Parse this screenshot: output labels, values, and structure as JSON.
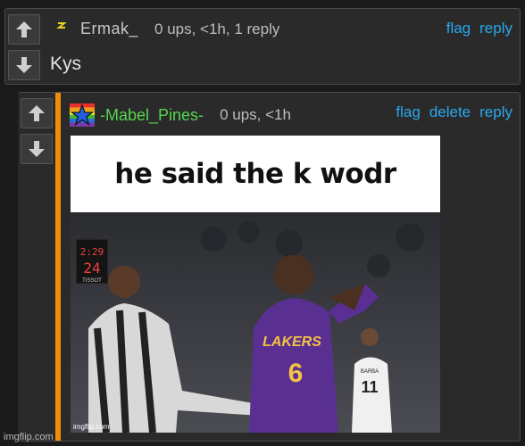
{
  "comments": [
    {
      "username": "Ermak_",
      "meta": "0 ups, <1h, 1 reply",
      "actions": [
        "flag",
        "reply"
      ],
      "text": "Kys"
    },
    {
      "username": "-Mabel_Pines-",
      "meta": "0 ups, <1h",
      "actions": [
        "flag",
        "delete",
        "reply"
      ],
      "meme": {
        "caption": "he said the k wodr",
        "shot_clock_time": "2:29",
        "shot_clock_seconds": "24",
        "clock_brand": "TISSOT",
        "jersey_team": "LAKERS",
        "jersey_number": "6",
        "player2_name": "BARBA",
        "player2_number": "11",
        "meme_watermark": "imgflip.com"
      }
    }
  ],
  "watermark": "imgflip.com",
  "colors": {
    "background": "#1a1a1a",
    "panel": "#2a2a2a",
    "link": "#29a8ee",
    "username2": "#56d54f",
    "reply_bar": "#f28c0e"
  }
}
